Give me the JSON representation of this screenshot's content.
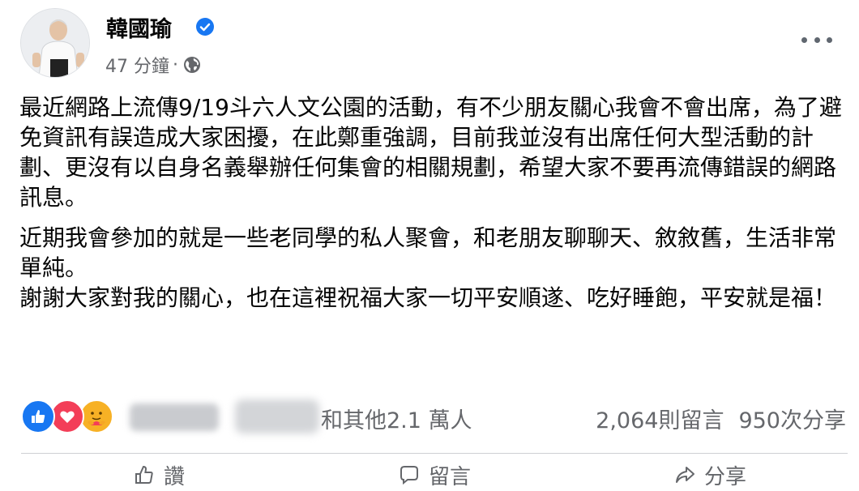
{
  "post": {
    "author": "韓國瑜",
    "timestamp": "47 分鐘",
    "separator": "·",
    "paragraphs": [
      "最近網路上流傳9/19斗六人文公園的活動，有不少朋友關心我會不會出席，為了避免資訊有誤造成大家困擾，在此鄭重強調，目前我並沒有出席任何大型活動的計劃、更沒有以自身名義舉辦任何集會的相關規劃，希望大家不要再流傳錯誤的網路訊息。",
      "近期我會參加的就是一些老同學的私人聚會，和老朋友聊聊天、敘敘舊，生活非常單純。\n謝謝大家對我的關心，也在這裡祝福大家一切平安順遂、吃好睡飽，平安就是福！"
    ]
  },
  "engagement": {
    "reactions": [
      "like-icon",
      "love-icon",
      "care-icon"
    ],
    "others_text": "和其他2.1 萬人",
    "comments": "2,064則留言",
    "shares": "950次分享"
  },
  "actions": [
    {
      "icon": "like-outline-icon",
      "label": "讚"
    },
    {
      "icon": "comment-icon",
      "label": "留言"
    },
    {
      "icon": "share-icon",
      "label": "分享"
    }
  ],
  "colors": {
    "like": "#1877f2",
    "love": "#f33e58",
    "care": "#f7b125",
    "verified": "#1877f2",
    "secondary_text": "#65676b"
  }
}
